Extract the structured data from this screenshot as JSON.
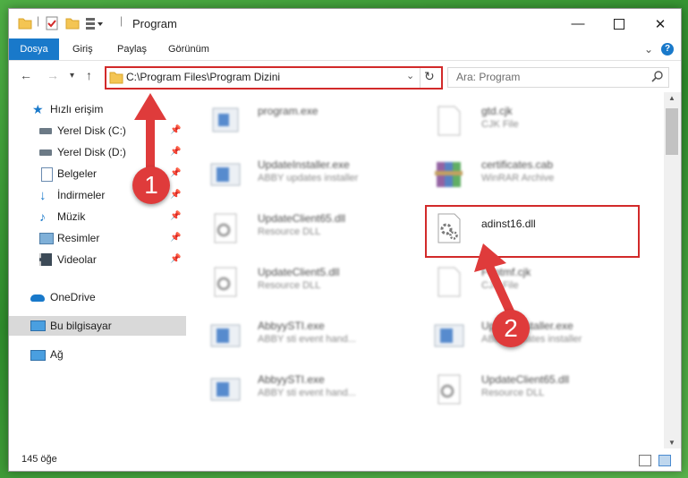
{
  "window": {
    "title": "Program",
    "minimize_icon": "minimize-icon",
    "maximize_icon": "maximize-icon",
    "close_icon": "close-icon"
  },
  "ribbon": {
    "tabs": [
      "Dosya",
      "Giriş",
      "Paylaş",
      "Görünüm"
    ]
  },
  "nav": {
    "address": "C:\\Program Files\\Program Dizini",
    "search_placeholder": "Ara: Program"
  },
  "sidebar": {
    "items": [
      {
        "label": "Hızlı erişim",
        "icon": "star-icon"
      },
      {
        "label": "Yerel Disk (C:)",
        "icon": "drive-icon",
        "pinned": true
      },
      {
        "label": "Yerel Disk (D:)",
        "icon": "drive-icon",
        "pinned": true
      },
      {
        "label": "Belgeler",
        "icon": "documents-icon",
        "pinned": true
      },
      {
        "label": "İndirmeler",
        "icon": "download-icon",
        "pinned": true
      },
      {
        "label": "Müzik",
        "icon": "music-icon",
        "pinned": true
      },
      {
        "label": "Resimler",
        "icon": "pictures-icon",
        "pinned": true
      },
      {
        "label": "Videolar",
        "icon": "videos-icon",
        "pinned": true
      },
      {
        "label": "OneDrive",
        "icon": "cloud-icon"
      },
      {
        "label": "Bu bilgisayar",
        "icon": "computer-icon",
        "selected": true
      },
      {
        "label": "Ağ",
        "icon": "network-icon"
      }
    ]
  },
  "files": {
    "left": [
      {
        "name": "program.exe",
        "desc": "",
        "icon": "exe-icon"
      },
      {
        "name": "UpdateInstaller.exe",
        "desc": "ABBY updates installer",
        "icon": "exe-icon"
      },
      {
        "name": "UpdateClient65.dll",
        "desc": "Resource DLL",
        "icon": "dll-icon"
      },
      {
        "name": "UpdateClient5.dll",
        "desc": "Resource DLL",
        "icon": "dll-icon"
      },
      {
        "name": "AbbyySTI.exe",
        "desc": "ABBY sti event hand...",
        "icon": "exe-icon"
      },
      {
        "name": "AbbyySTI.exe",
        "desc": "ABBY sti event hand...",
        "icon": "exe-icon"
      }
    ],
    "right": [
      {
        "name": "gtd.cjk",
        "desc": "CJK File",
        "icon": "file-icon"
      },
      {
        "name": "certificates.cab",
        "desc": "WinRAR Archive",
        "icon": "archive-icon"
      },
      {
        "name": "adinst16.dll",
        "desc": "",
        "icon": "dll-icon"
      },
      {
        "name": "Fontmf.cjk",
        "desc": "CJK File",
        "icon": "file-icon"
      },
      {
        "name": "UpdateInstaller.exe",
        "desc": "ABBY updates installer",
        "icon": "exe-icon"
      },
      {
        "name": "UpdateClient65.dll",
        "desc": "Resource DLL",
        "icon": "dll-icon"
      }
    ]
  },
  "status": {
    "count": "145 öğe"
  },
  "annotations": {
    "step1": "1",
    "step2": "2",
    "color": "#d22a2a"
  }
}
